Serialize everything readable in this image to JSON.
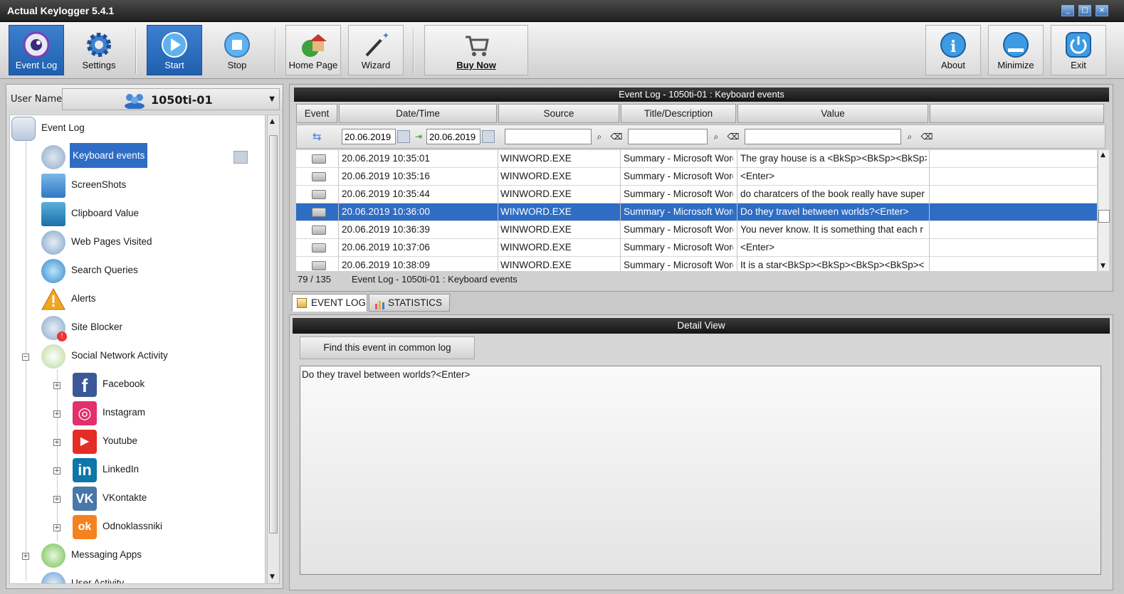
{
  "window": {
    "title": "Actual Keylogger 5.4.1"
  },
  "toolbar": {
    "event_log": "Event Log",
    "settings": "Settings",
    "start": "Start",
    "stop": "Stop",
    "home_page": "Home Page",
    "wizard": "Wizard",
    "buy_now": "Buy Now",
    "about": "About",
    "minimize": "Minimize",
    "exit": "Exit"
  },
  "sidebar": {
    "user_label": "User Name",
    "user_value": "1050ti-01",
    "root": "Event Log",
    "items": [
      {
        "label": "Keyboard events",
        "icon": "keyboard-icon"
      },
      {
        "label": "ScreenShots",
        "icon": "monitor-icon"
      },
      {
        "label": "Clipboard Value",
        "icon": "clipboard-icon"
      },
      {
        "label": "Web Pages Visited",
        "icon": "globe-icon"
      },
      {
        "label": "Search Queries",
        "icon": "magnifier-icon"
      },
      {
        "label": "Alerts",
        "icon": "warning-icon"
      },
      {
        "label": "Site Blocker",
        "icon": "site-blocker-icon"
      },
      {
        "label": "Social Network Activity",
        "icon": "chat-bubbles-icon"
      }
    ],
    "social": [
      {
        "label": "Facebook",
        "glyph": "f",
        "color": "#3b5998"
      },
      {
        "label": "Instagram",
        "glyph": "◎",
        "color": "#e1306c"
      },
      {
        "label": "Youtube",
        "glyph": "▶",
        "color": "#e52d27"
      },
      {
        "label": "LinkedIn",
        "glyph": "in",
        "color": "#0e76a8"
      },
      {
        "label": "VKontakte",
        "glyph": "VK",
        "color": "#4a76a8"
      },
      {
        "label": "Odnoklassniki",
        "glyph": "ok",
        "color": "#f58220"
      }
    ],
    "messaging": "Messaging Apps",
    "user_activity": "User Activity"
  },
  "grid": {
    "title": "Event Log - 1050ti-01 : Keyboard events",
    "columns": [
      "Event",
      "Date/Time",
      "Source",
      "Title/Description",
      "Value"
    ],
    "filter_from": "20.06.2019",
    "filter_to": "20.06.2019",
    "rows": [
      {
        "datetime": "20.06.2019 10:35:01",
        "source": "WINWORD.EXE",
        "title": "Summary - Microsoft Word",
        "value": "The gray house is a <BkSp><BkSp><BkSp>"
      },
      {
        "datetime": "20.06.2019 10:35:16",
        "source": "WINWORD.EXE",
        "title": "Summary - Microsoft Word",
        "value": "<Enter>"
      },
      {
        "datetime": "20.06.2019 10:35:44",
        "source": "WINWORD.EXE",
        "title": "Summary - Microsoft Word",
        "value": "do charatcers of the book really have super"
      },
      {
        "datetime": "20.06.2019 10:36:00",
        "source": "WINWORD.EXE",
        "title": "Summary - Microsoft Word",
        "value": "Do they travel between worlds?<Enter>"
      },
      {
        "datetime": "20.06.2019 10:36:39",
        "source": "WINWORD.EXE",
        "title": "Summary - Microsoft Word",
        "value": "You never know. It is something that each r"
      },
      {
        "datetime": "20.06.2019 10:37:06",
        "source": "WINWORD.EXE",
        "title": "Summary - Microsoft Word",
        "value": "<Enter>"
      },
      {
        "datetime": "20.06.2019 10:38:09",
        "source": "WINWORD.EXE",
        "title": "Summary - Microsoft Word",
        "value": "It is a star<BkSp><BkSp><BkSp><BkSp><"
      }
    ],
    "status_count": "79 / 135",
    "status_text": "Event Log - 1050ti-01 : Keyboard events"
  },
  "tabs": {
    "event_log": "EVENT LOG",
    "statistics": "STATISTICS"
  },
  "detail": {
    "title": "Detail View",
    "find_button": "Find this event in common log",
    "text": "Do they travel between worlds?<Enter>"
  },
  "colors": {
    "accent": "#2f6cc4",
    "header_dark": "#1a1a1a"
  }
}
